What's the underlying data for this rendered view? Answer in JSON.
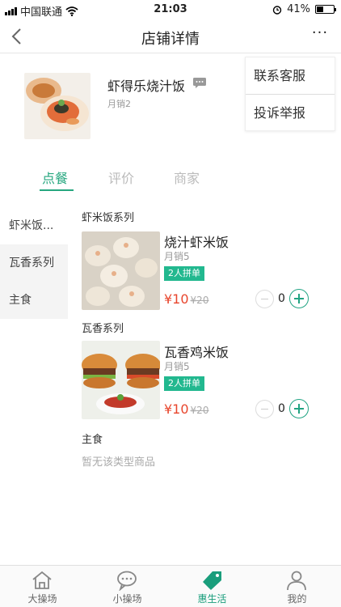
{
  "status_bar": {
    "carrier": "中国联通",
    "time": "21:03",
    "battery": "41%"
  },
  "nav": {
    "title": "店铺详情",
    "more": "···"
  },
  "shop": {
    "name": "虾得乐烧汁饭",
    "sales": "月销2"
  },
  "menu": {
    "items": [
      "联系客服",
      "投诉举报"
    ]
  },
  "tabs": {
    "items": [
      "点餐",
      "评价",
      "商家"
    ],
    "active": "点餐"
  },
  "categories": [
    "虾米饭...",
    "瓦香系列",
    "主食"
  ],
  "sections": [
    {
      "title": "虾米饭系列",
      "product": {
        "name": "烧汁虾米饭",
        "sales": "月销5",
        "badge": "2人拼单",
        "price": "¥10",
        "old_price": "¥20",
        "quantity": "0"
      }
    },
    {
      "title": "瓦香系列",
      "product": {
        "name": "瓦香鸡米饭",
        "sales": "月销5",
        "badge": "2人拼单",
        "price": "¥10",
        "old_price": "¥20",
        "quantity": "0"
      }
    },
    {
      "title": "主食",
      "empty_text": "暂无该类型商品"
    }
  ],
  "tabbar": {
    "items": [
      "大操场",
      "小操场",
      "惠生活",
      "我的"
    ],
    "active": "惠生活"
  },
  "colors": {
    "accent": "#26a77f",
    "price": "#e8452c",
    "badge": "#22b88f"
  }
}
